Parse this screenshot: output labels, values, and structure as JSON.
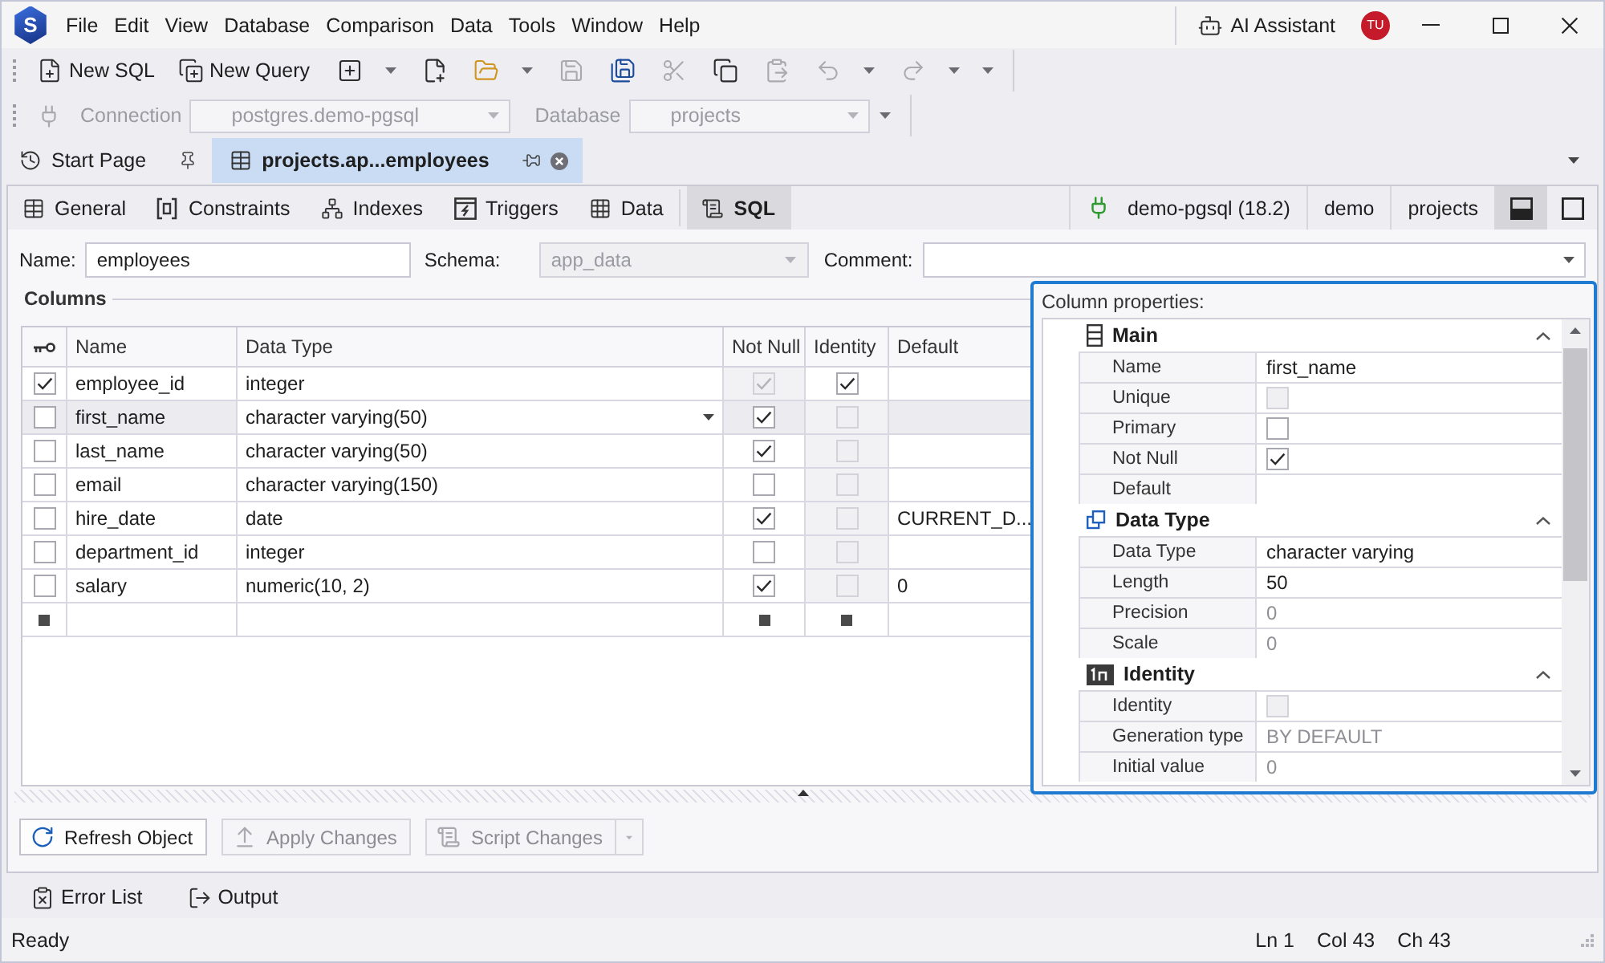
{
  "logo": {
    "letter": "S"
  },
  "menu": [
    "File",
    "Edit",
    "View",
    "Database",
    "Comparison",
    "Data",
    "Tools",
    "Window",
    "Help"
  ],
  "title_bar": {
    "assistant_label": "AI Assistant",
    "user_initials": "TU"
  },
  "toolbar": [
    {
      "kind": "button",
      "label": "New SQL",
      "disabled": false
    },
    {
      "kind": "button",
      "label": "New Query",
      "disabled": false
    },
    {
      "kind": "icon",
      "disabled": false
    },
    {
      "kind": "dropdown"
    },
    {
      "kind": "icon",
      "disabled": false
    },
    {
      "kind": "icon",
      "disabled": false
    },
    {
      "kind": "dropdown"
    },
    {
      "kind": "icon",
      "disabled": true
    },
    {
      "kind": "icon",
      "disabled": false
    },
    {
      "kind": "icon",
      "disabled": true
    },
    {
      "kind": "icon",
      "disabled": false
    },
    {
      "kind": "icon",
      "disabled": true
    },
    {
      "kind": "icon",
      "disabled": true
    },
    {
      "kind": "dropdown"
    },
    {
      "kind": "icon",
      "disabled": true
    },
    {
      "kind": "dropdown"
    },
    {
      "kind": "dropdown"
    }
  ],
  "connection_bar": {
    "connection_label": "Connection",
    "connection": "postgres.demo-pgsql",
    "database_label": "Database",
    "database": "projects",
    "disabled": true
  },
  "document_tabs": [
    {
      "title": "Start Page",
      "selected": false
    },
    {
      "title": "projects.ap...employees",
      "selected": true
    }
  ],
  "editor": {
    "tabs": [
      {
        "label": "General",
        "selected": false
      },
      {
        "label": "Constraints",
        "selected": false
      },
      {
        "label": "Indexes",
        "selected": false
      },
      {
        "label": "Triggers",
        "selected": false
      },
      {
        "label": "Data",
        "selected": false
      },
      {
        "label": "SQL",
        "selected": true
      }
    ],
    "connection_info": [
      "demo-pgsql (18.2)",
      "demo",
      "projects"
    ],
    "layout_buttons": [
      {
        "selected": true
      },
      {
        "selected": false
      }
    ],
    "form": {
      "name_label": "Name:",
      "name": "employees",
      "schema_label": "Schema:",
      "schema": "app_data",
      "comment_label": "Comment:"
    },
    "columns_title": "Columns",
    "table": {
      "columns": [
        "Name",
        "Data Type",
        "Not Null",
        "Identity",
        "Default"
      ],
      "rows": [
        {
          "kind": "column",
          "selected": false,
          "primary_key": true,
          "name": "employee_id",
          "data_type": "integer",
          "not_null": true,
          "not_null_disabled": true,
          "identity": true,
          "identity_disabled": false
        },
        {
          "kind": "column",
          "selected": true,
          "primary_key": false,
          "name": "first_name",
          "data_type": "character varying(50)",
          "not_null": true,
          "not_null_disabled": false,
          "identity": false,
          "identity_disabled": true
        },
        {
          "kind": "column",
          "selected": false,
          "primary_key": false,
          "name": "last_name",
          "data_type": "character varying(50)",
          "not_null": true,
          "not_null_disabled": false,
          "identity": false,
          "identity_disabled": true
        },
        {
          "kind": "column",
          "selected": false,
          "primary_key": false,
          "name": "email",
          "data_type": "character varying(150)",
          "not_null": false,
          "not_null_disabled": false,
          "identity": false,
          "identity_disabled": true
        },
        {
          "kind": "column",
          "selected": false,
          "primary_key": false,
          "name": "hire_date",
          "data_type": "date",
          "not_null": true,
          "not_null_disabled": false,
          "identity": false,
          "identity_disabled": true,
          "default": "CURRENT_D..."
        },
        {
          "kind": "column",
          "selected": false,
          "primary_key": false,
          "name": "department_id",
          "data_type": "integer",
          "not_null": false,
          "not_null_disabled": false,
          "identity": false,
          "identity_disabled": true
        },
        {
          "kind": "column",
          "selected": false,
          "primary_key": false,
          "name": "salary",
          "data_type": "numeric(10, 2)",
          "not_null": true,
          "not_null_disabled": false,
          "identity": false,
          "identity_disabled": true,
          "default": "0"
        },
        {
          "kind": "new",
          "selected": false
        }
      ]
    },
    "properties": {
      "title": "Column properties:",
      "sections": [
        {
          "title": "Main",
          "expanded": true,
          "rows": [
            {
              "kind": "text",
              "label": "Name",
              "value": "first_name",
              "dimmed": false
            },
            {
              "kind": "checkbox",
              "label": "Unique",
              "checked": false,
              "disabled": true
            },
            {
              "kind": "checkbox",
              "label": "Primary",
              "checked": false,
              "disabled": false
            },
            {
              "kind": "checkbox",
              "label": "Not Null",
              "checked": true,
              "disabled": false
            },
            {
              "kind": "text",
              "label": "Default"
            }
          ]
        },
        {
          "title": "Data Type",
          "expanded": true,
          "rows": [
            {
              "kind": "text",
              "label": "Data Type",
              "value": "character varying",
              "dimmed": false
            },
            {
              "kind": "text",
              "label": "Length",
              "value": "50",
              "dimmed": false
            },
            {
              "kind": "text",
              "label": "Precision",
              "value": "0",
              "dimmed": true
            },
            {
              "kind": "text",
              "label": "Scale",
              "value": "0",
              "dimmed": true
            }
          ]
        },
        {
          "title": "Identity",
          "expanded": true,
          "rows": [
            {
              "kind": "checkbox",
              "label": "Identity",
              "checked": false,
              "disabled": true
            },
            {
              "kind": "text",
              "label": "Generation type",
              "value": "BY DEFAULT",
              "dimmed": true
            },
            {
              "kind": "text",
              "label": "Initial value",
              "value": "0",
              "dimmed": true
            }
          ]
        }
      ]
    },
    "buttons": [
      {
        "label": "Refresh Object",
        "disabled": false,
        "has_menu": false
      },
      {
        "label": "Apply Changes",
        "disabled": true,
        "has_menu": false
      },
      {
        "label": "Script Changes",
        "disabled": true,
        "has_menu": true
      }
    ]
  },
  "tool_tabs": [
    "Error List",
    "Output"
  ],
  "status_bar": {
    "message": "Ready",
    "position": [
      "Ln 1",
      "Col 43",
      "Ch 43"
    ]
  }
}
